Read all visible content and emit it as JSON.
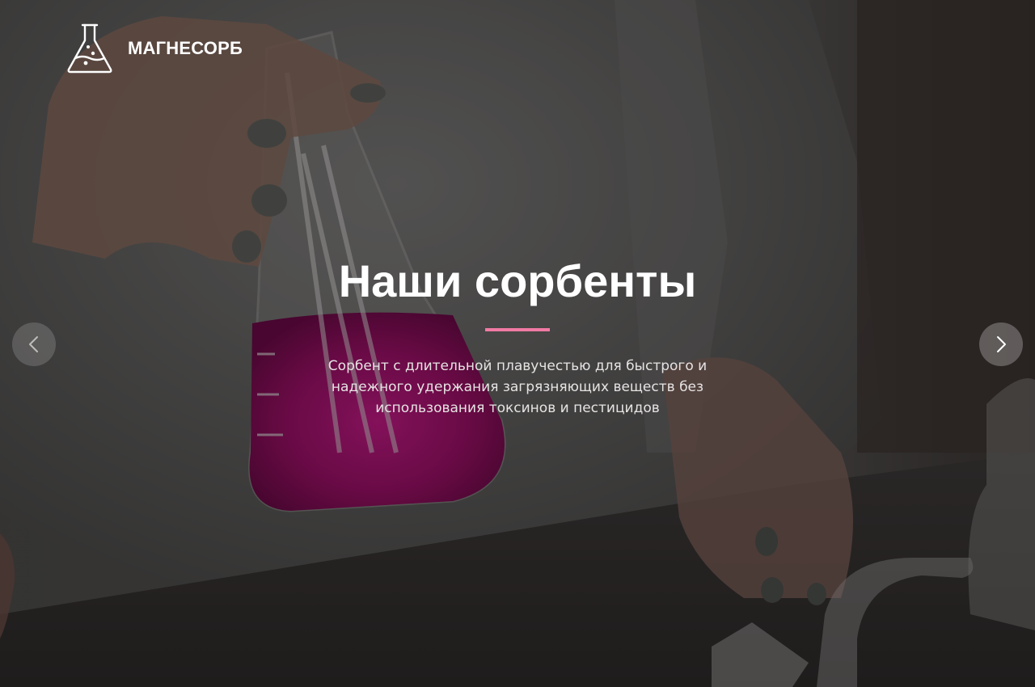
{
  "brand": {
    "name": "МАГНЕСОРБ",
    "logo_icon": "flask-icon"
  },
  "hero": {
    "title": "Наши сорбенты",
    "subtitle": "Сорбент с длительной плавучестью для быстрого и надежного удержания загрязняющих веществ без использования токсинов и пестицидов",
    "accent_color": "#f07aa3",
    "background_image": "laboratory-flask-with-pink-liquid"
  },
  "slider": {
    "prev_icon": "chevron-left-icon",
    "next_icon": "chevron-right-icon"
  }
}
